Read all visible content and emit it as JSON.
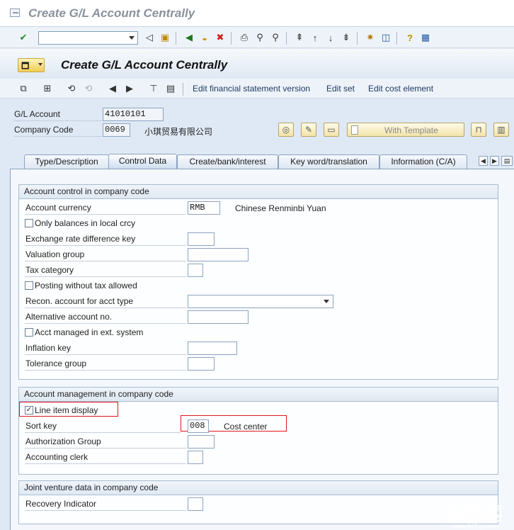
{
  "window": {
    "title": "Create G/L Account Centrally"
  },
  "header": {
    "title": "Create G/L Account Centrally"
  },
  "toolbar2": {
    "edit_fs_version": "Edit financial statement version",
    "edit_set": "Edit set",
    "edit_cost_element": "Edit cost element"
  },
  "account": {
    "gl_label": "G/L Account",
    "gl_value": "41010101",
    "company_label": "Company Code",
    "company_value": "0069",
    "company_name": "小琪贸易有限公司",
    "with_template": "With Template"
  },
  "tabs": [
    {
      "label": "Type/Description"
    },
    {
      "label": "Control Data"
    },
    {
      "label": "Create/bank/interest"
    },
    {
      "label": "Key word/translation"
    },
    {
      "label": "Information (C/A)"
    }
  ],
  "group_control": {
    "title": "Account control in company code",
    "account_currency": "Account currency",
    "currency_value": "RMB",
    "currency_text": "Chinese Renminbi Yuan",
    "only_balances": "Only balances in local crcy",
    "exchange_rate_key": "Exchange rate difference key",
    "valuation_group": "Valuation group",
    "tax_category": "Tax category",
    "posting_without_tax": "Posting without tax allowed",
    "recon_account": "Recon. account for acct type",
    "alternative_account": "Alternative account no.",
    "acct_managed_ext": "Acct managed in ext. system",
    "inflation_key": "Inflation key",
    "tolerance_group": "Tolerance group"
  },
  "group_management": {
    "title": "Account management in company code",
    "line_item_display": "Line item display",
    "line_item_checked": true,
    "sort_key": "Sort key",
    "sort_key_value": "008",
    "sort_key_text": "Cost center",
    "authorization_group": "Authorization Group",
    "accounting_clerk": "Accounting clerk"
  },
  "group_joint_venture": {
    "title": "Joint venture data in company code",
    "recovery_indicator": "Recovery Indicator"
  },
  "watermark": {
    "main": "赛跑网",
    "sub": "www.915ap.com"
  }
}
